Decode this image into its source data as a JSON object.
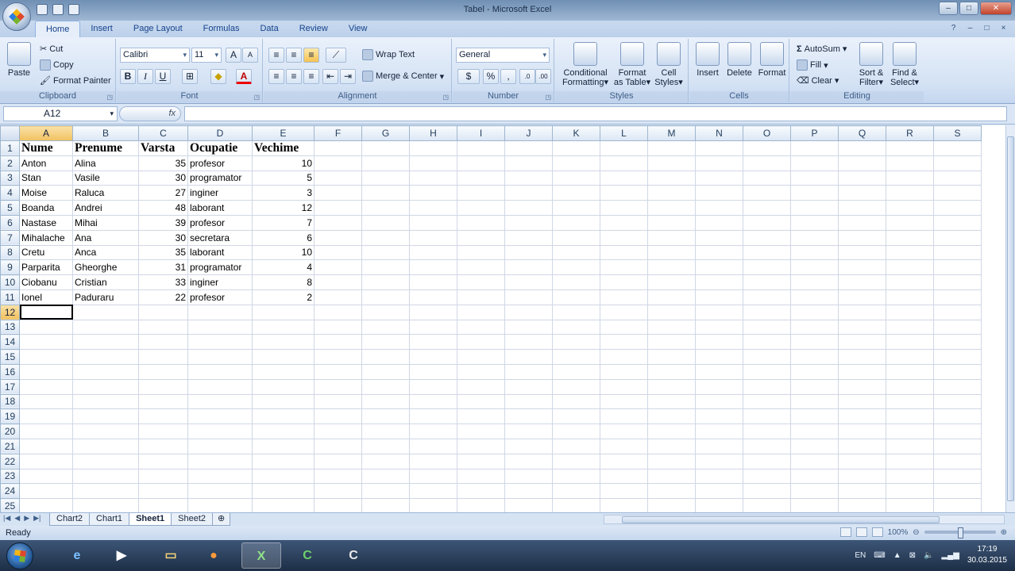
{
  "window": {
    "title": "Tabel - Microsoft Excel",
    "controls": [
      "–",
      "□",
      "✕"
    ]
  },
  "ribbon": {
    "tabs": [
      "Home",
      "Insert",
      "Page Layout",
      "Formulas",
      "Data",
      "Review",
      "View"
    ],
    "active_tab": "Home",
    "clipboard": {
      "label": "Clipboard",
      "paste": "Paste",
      "cut": "Cut",
      "copy": "Copy",
      "format_painter": "Format Painter"
    },
    "font": {
      "label": "Font",
      "name": "Calibri",
      "size": "11",
      "bold": "B",
      "italic": "I",
      "underline": "U",
      "grow": "A",
      "shrink": "A",
      "font_color": "A"
    },
    "alignment": {
      "label": "Alignment",
      "wrap_text": "Wrap Text",
      "merge_center": "Merge & Center"
    },
    "number": {
      "label": "Number",
      "format": "General",
      "percent": "%",
      "comma": ","
    },
    "styles": {
      "label": "Styles",
      "conditional_1": "Conditional",
      "conditional_2": "Formatting",
      "format_table_1": "Format",
      "format_table_2": "as Table",
      "cell_styles_1": "Cell",
      "cell_styles_2": "Styles"
    },
    "cells": {
      "label": "Cells",
      "insert": "Insert",
      "delete": "Delete",
      "format": "Format"
    },
    "editing": {
      "label": "Editing",
      "autosum": "AutoSum",
      "fill": "Fill",
      "clear": "Clear",
      "sort_1": "Sort &",
      "sort_2": "Filter",
      "find_1": "Find &",
      "find_2": "Select"
    }
  },
  "formula_bar": {
    "name_box": "A12",
    "fx": "fx",
    "content": ""
  },
  "grid": {
    "columns": [
      "A",
      "B",
      "C",
      "D",
      "E",
      "F",
      "G",
      "H",
      "I",
      "J",
      "K",
      "L",
      "M",
      "N",
      "O",
      "P",
      "Q",
      "R",
      "S"
    ],
    "row_numbers": [
      "1",
      "2",
      "3",
      "4",
      "5",
      "6",
      "7",
      "8",
      "9",
      "10",
      "11",
      "12",
      "13",
      "14",
      "15",
      "16",
      "17",
      "18",
      "19",
      "20",
      "21",
      "22",
      "23",
      "24",
      "25"
    ],
    "headers": [
      "Nume",
      "Prenume",
      "Varsta",
      "Ocupatie",
      "Vechime"
    ],
    "rows": [
      [
        "Anton",
        "Alina",
        "35",
        "profesor",
        "10"
      ],
      [
        "Stan",
        "Vasile",
        "30",
        "programator",
        "5"
      ],
      [
        "Moise",
        "Raluca",
        "27",
        "inginer",
        "3"
      ],
      [
        "Boanda",
        "Andrei",
        "48",
        "laborant",
        "12"
      ],
      [
        "Nastase",
        "Mihai",
        "39",
        "profesor",
        "7"
      ],
      [
        "Mihalache",
        "Ana",
        "30",
        "secretara",
        "6"
      ],
      [
        "Cretu",
        "Anca",
        "35",
        "laborant",
        "10"
      ],
      [
        "Parparita",
        "Gheorghe",
        "31",
        "programator",
        "4"
      ],
      [
        "Ciobanu",
        "Cristian",
        "33",
        "inginer",
        "8"
      ],
      [
        "Ionel",
        "Paduraru",
        "22",
        "profesor",
        "2"
      ]
    ],
    "active_cell": "A12"
  },
  "sheets": {
    "tabs": [
      "Chart2",
      "Chart1",
      "Sheet1",
      "Sheet2"
    ],
    "active": "Sheet1"
  },
  "status": {
    "ready": "Ready",
    "zoom": "100%"
  },
  "taskbar": {
    "lang": "EN",
    "time": "17:19",
    "date": "30.03.2015"
  }
}
